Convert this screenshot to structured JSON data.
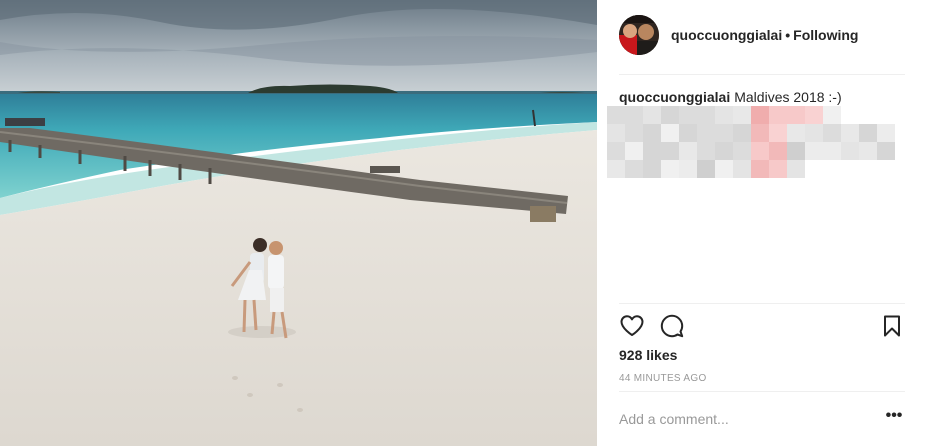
{
  "post": {
    "username": "quoccuonggialai",
    "follow_status": "Following",
    "separator": "•",
    "caption": {
      "username": "quoccuonggialai",
      "text": "Maldives 2018 :-)"
    },
    "likes": "928 likes",
    "timestamp": "44 MINUTES AGO"
  },
  "comment": {
    "placeholder": "Add a comment..."
  },
  "more_label": "•••",
  "icons": {
    "like": "heart-icon",
    "comment": "comment-icon",
    "save": "bookmark-icon"
  },
  "colors": {
    "text": "#262626",
    "muted": "#999999",
    "divider": "#efefef",
    "sea": "#3fb9c0",
    "sand": "#ece8e2"
  }
}
